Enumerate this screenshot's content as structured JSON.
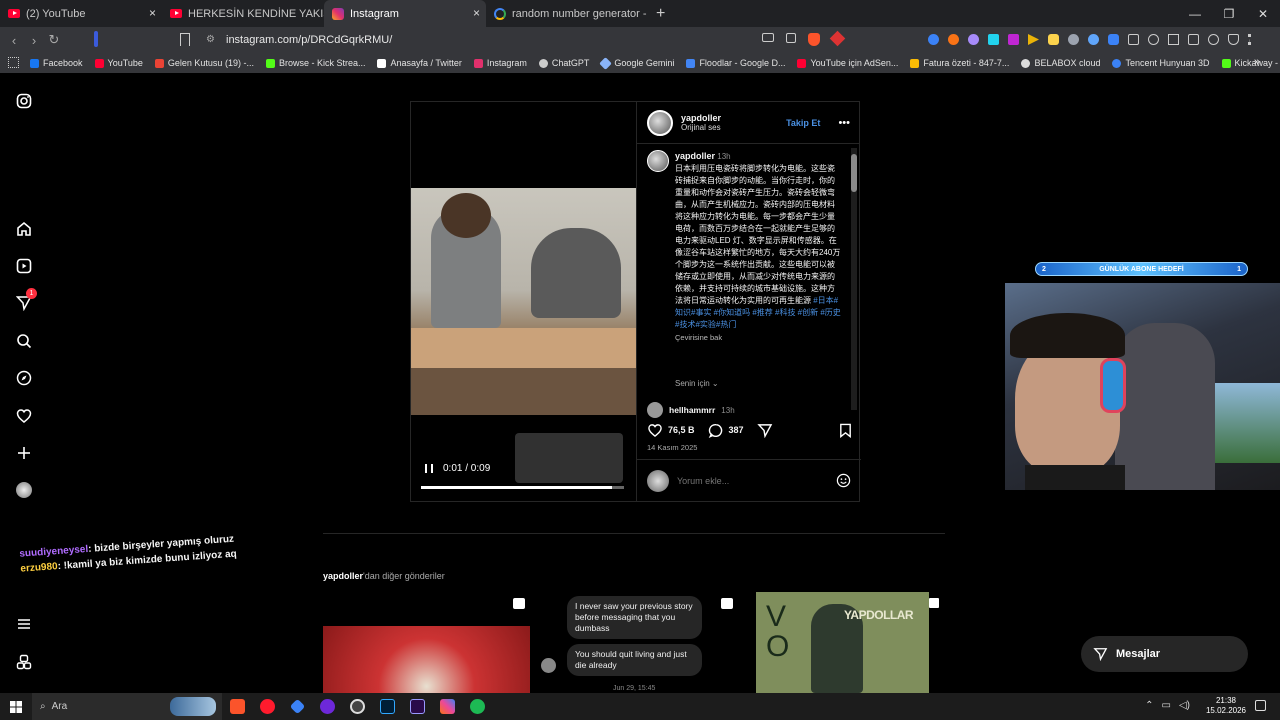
{
  "tabs": [
    {
      "title": "(2) YouTube",
      "icon": "youtube-icon"
    },
    {
      "title": "HERKESİN KENDİNE YAKIŞANI YAPTIĞ",
      "icon": "youtube-icon"
    },
    {
      "title": "Instagram",
      "icon": "instagram-icon"
    },
    {
      "title": "random number generator - Google",
      "icon": "google-icon"
    }
  ],
  "tab_close": "×",
  "new_tab": "+",
  "window_controls": {
    "minimize": "—",
    "restore": "❐",
    "close": "✕"
  },
  "address": {
    "url": "instagram.com/p/DRCdGqrkRMU/"
  },
  "bookmarks": [
    {
      "label": "Facebook",
      "color": "#1877f2"
    },
    {
      "label": "YouTube",
      "color": "#ff0033"
    },
    {
      "label": "Gelen Kutusu (19) -...",
      "color": "#ea4335"
    },
    {
      "label": "Browse - Kick Strea...",
      "color": "#53fc18"
    },
    {
      "label": "Anasayfa / Twitter",
      "color": "#ffffff"
    },
    {
      "label": "Instagram",
      "color": "#e1306c"
    },
    {
      "label": "ChatGPT",
      "color": "#cccccc"
    },
    {
      "label": "Google Gemini",
      "color": "#8ab4f8"
    },
    {
      "label": "Floodlar - Google D...",
      "color": "#4285f4"
    },
    {
      "label": "YouTube için AdSen...",
      "color": "#fbbc05"
    },
    {
      "label": "Fatura özeti - 847-7...",
      "color": "#34a853"
    },
    {
      "label": "BELABOX cloud",
      "color": "#dddddd"
    },
    {
      "label": "Tencent Hunyuan 3D",
      "color": "#3b82f6"
    },
    {
      "label": "Kickaway - Kick Çeki...",
      "color": "#53fc18"
    }
  ],
  "post": {
    "username": "yapdoller",
    "audio": "Orijinal ses",
    "follow": "Takip Et",
    "more": "•••",
    "caption_time": "13h",
    "caption": "日本利用压电瓷砖将脚步转化为电能。这些瓷砖捕捉来自你脚步的动能。当你行走时，你的重量和动作会对瓷砖产生压力。瓷砖会轻微弯曲，从而产生机械应力。瓷砖内部的压电材料将这种应力转化为电能。每一步都会产生少量电荷，而数百万步结合在一起就能产生足够的电力来驱动LED 灯、数字显示屏和传感器。在像涩谷车站这样繁忙的地方，每天大约有240万个脚步为这一系统作出贡献。这些电能可以被储存或立即使用，从而减少对传统电力来源的依赖，并支持可持续的城市基础设施。这种方法将日常运动转化为实用的可再生能源",
    "hashtags": "#日本#知识#事实 #你知道吗 #推荐 #科技 #创新 #历史 #技术#实验#热门",
    "translate": "Çevirisine bak",
    "for_you": "Senin için",
    "next_comment_user": "hellhammrr",
    "next_comment_time": "13h",
    "likes": "76,5 B",
    "comments": "387",
    "date": "14 Kasım 2025",
    "comment_placeholder": "Yorum ekle...",
    "video_time": "0:01 / 0:09",
    "video_progress": 0.94
  },
  "more_posts": {
    "user": "yapdoller",
    "suffix": "'dan diğer gönderiler",
    "dm_message_1": "I never saw your previous story before messaging that you dumbass",
    "dm_message_2": "You should quit living and just die already",
    "dm_timestamp": "Jun 29, 15:45",
    "poster_letters": "V O",
    "poster_title": "YAPDOLLAR"
  },
  "stream": {
    "goal_left": "2",
    "goal_label": "GÜNLÜK ABONE HEDEFİ",
    "goal_right": "1"
  },
  "chat": [
    {
      "user": "suudiyeneysel",
      "msg": ": bizde birşeyler yapmış oluruz"
    },
    {
      "user": "erzu980",
      "msg": ": !kamil ya biz kimizde bunu izliyoz aq"
    }
  ],
  "messages_button": "Mesajlar",
  "notification_badge": "1",
  "taskbar": {
    "search_placeholder": "Ara",
    "time": "21:38",
    "date": "15.02.2026"
  }
}
